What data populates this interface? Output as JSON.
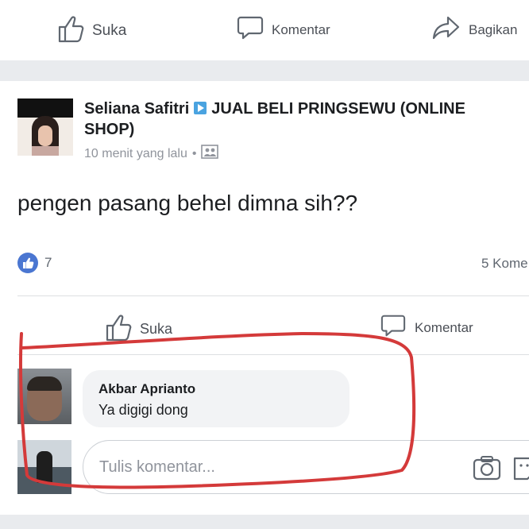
{
  "top_actions": {
    "like_label": "Suka",
    "comment_label": "Komentar",
    "share_label": "Bagikan"
  },
  "post": {
    "author": "Seliana Safitri",
    "group": "JUAL BELI PRINGSEWU (ONLINE SHOP)",
    "time": "10 menit yang lalu",
    "separator": "•",
    "text": "pengen pasang behel dimna sih??",
    "reaction_count": "7",
    "comment_count": "5 Kome",
    "actions": {
      "like_label": "Suka",
      "comment_label": "Komentar"
    }
  },
  "comment": {
    "author": "Akbar Aprianto",
    "text": "Ya digigi dong"
  },
  "composer": {
    "placeholder": "Tulis komentar..."
  },
  "colors": {
    "like_blue": "#4a76d1",
    "annotation_red": "#d43a3a",
    "band_gray": "#e9ebee"
  }
}
